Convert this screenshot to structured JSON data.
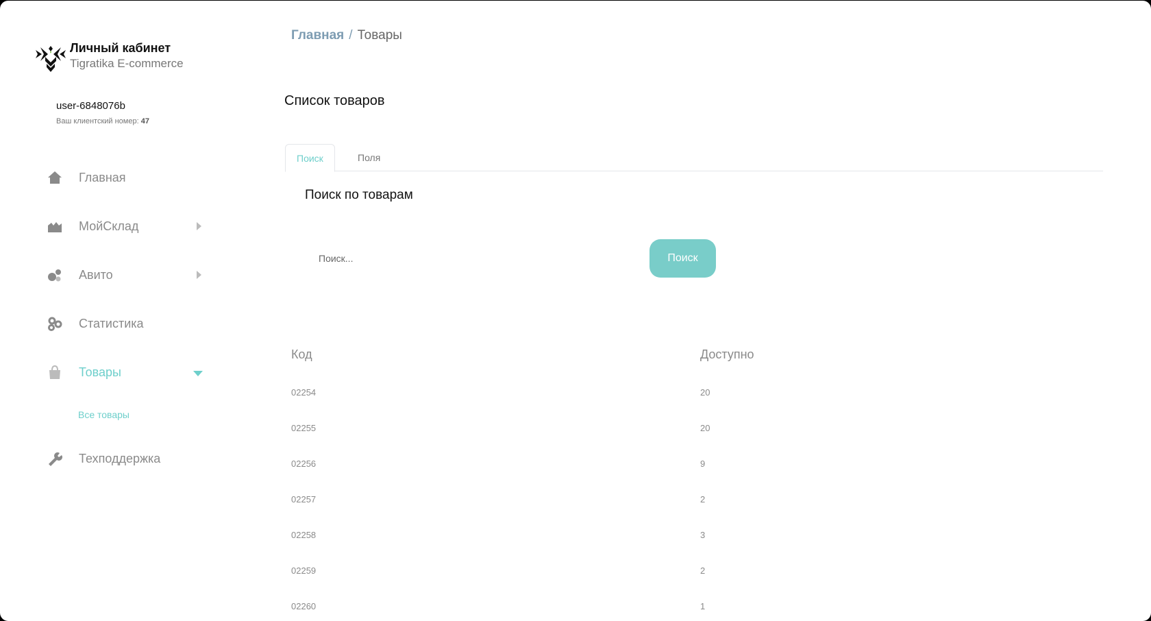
{
  "brand": {
    "title": "Личный кабинет",
    "subtitle": "Tigratika E-commerce"
  },
  "user": {
    "name": "user-6848076b",
    "client_label": "Ваш клиентский номер:",
    "client_number": "47"
  },
  "sidebar": {
    "items": [
      {
        "label": "Главная",
        "icon": "home-icon"
      },
      {
        "label": "МойСклад",
        "icon": "warehouse-icon"
      },
      {
        "label": "Авито",
        "icon": "avito-icon"
      },
      {
        "label": "Статистика",
        "icon": "stats-icon"
      },
      {
        "label": "Товары",
        "icon": "bag-icon"
      },
      {
        "label": "Техподдержка",
        "icon": "wrench-icon"
      }
    ],
    "sub_items": [
      {
        "label": "Все товары"
      }
    ]
  },
  "breadcrumb": {
    "home": "Главная",
    "separator": "/",
    "current": "Товары"
  },
  "page_title": "Список товаров",
  "tabs": [
    {
      "label": "Поиск",
      "active": true
    },
    {
      "label": "Поля",
      "active": false
    }
  ],
  "search": {
    "title": "Поиск по товарам",
    "placeholder": "Поиск...",
    "button_label": "Поиск"
  },
  "table": {
    "columns": [
      "Код",
      "Доступно"
    ],
    "rows": [
      [
        "02254",
        "20"
      ],
      [
        "02255",
        "20"
      ],
      [
        "02256",
        "9"
      ],
      [
        "02257",
        "2"
      ],
      [
        "02258",
        "3"
      ],
      [
        "02259",
        "2"
      ],
      [
        "02260",
        "1"
      ]
    ]
  },
  "colors": {
    "accent": "#6ecfcb",
    "button": "#79cdc9",
    "breadcrumb": "#7d9cb2"
  }
}
